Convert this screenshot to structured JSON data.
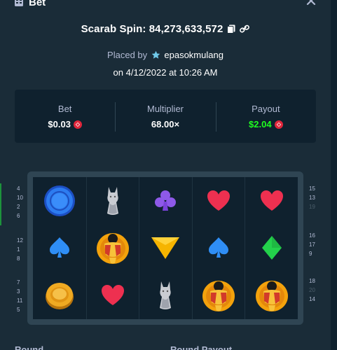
{
  "header": {
    "title": "Bet",
    "icon": "bet-icon",
    "close_icon": "close-icon"
  },
  "spin": {
    "label": "Scarab Spin: 84,273,633,572"
  },
  "placed": {
    "prefix": "Placed by",
    "user": "epasokmulang",
    "date": "on 4/12/2022 at 10:26 AM"
  },
  "stats": {
    "bet": {
      "label": "Bet",
      "value": "$0.03"
    },
    "multiplier": {
      "label": "Multiplier",
      "value": "68.00×"
    },
    "payout": {
      "label": "Payout",
      "value": "$2.04"
    }
  },
  "board": {
    "grid": [
      [
        "blue-chip",
        "cat-statue",
        "purple-club",
        "red-heart",
        "red-heart"
      ],
      [
        "blue-spade",
        "golden-scarab",
        "yellow-triangle",
        "blue-spade",
        "green-diamond"
      ],
      [
        "gold-coin",
        "red-heart",
        "cat-statue",
        "golden-scarab",
        "golden-scarab"
      ]
    ],
    "left_numbers": [
      [
        "4",
        "10",
        "2",
        "6"
      ],
      [
        "12",
        "1",
        "8"
      ],
      [
        "7",
        "3",
        "11",
        "5"
      ]
    ],
    "right_numbers": [
      [
        "15",
        "13",
        "19"
      ],
      [
        "16",
        "17",
        "9"
      ],
      [
        "18",
        "20",
        "14"
      ]
    ]
  },
  "footer": {
    "round_label": "Round",
    "round_payout_label": "Round Payout"
  },
  "colors": {
    "bg": "#1a2c38",
    "panel": "#0f212e",
    "green": "#1fff20",
    "muted": "#b1bad3"
  }
}
